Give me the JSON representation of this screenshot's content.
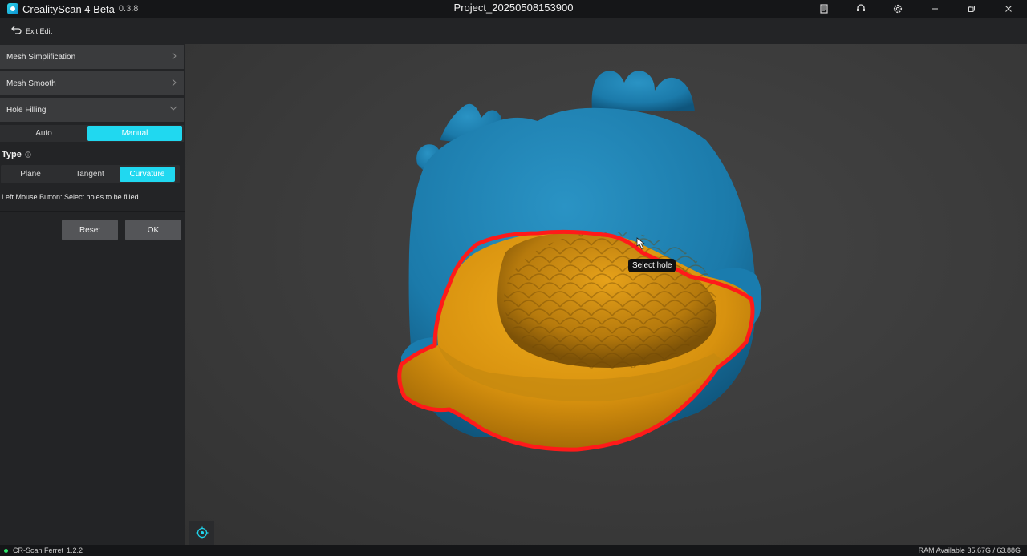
{
  "titlebar": {
    "app_name": "CrealityScan 4 Beta",
    "version": "0.3.8",
    "project": "Project_20250508153900",
    "icons": [
      "document-icon",
      "support-icon",
      "gear-icon",
      "minimize-icon",
      "restore-icon",
      "close-icon"
    ]
  },
  "toolbar": {
    "exit_label": "Exit Edit"
  },
  "panel": {
    "sections": [
      {
        "label": "Mesh Simplification",
        "state": "collapsed"
      },
      {
        "label": "Mesh Smooth",
        "state": "collapsed"
      },
      {
        "label": "Hole Filling",
        "state": "expanded"
      }
    ],
    "mode": {
      "options": [
        "Auto",
        "Manual"
      ],
      "selected": "Manual"
    },
    "type_label": "Type",
    "type": {
      "options": [
        "Plane",
        "Tangent",
        "Curvature"
      ],
      "selected": "Curvature"
    },
    "hint": "Left Mouse Button: Select holes to be filled",
    "reset_label": "Reset",
    "ok_label": "OK"
  },
  "viewport": {
    "tooltip": "Select hole",
    "colors": {
      "model": "#1f84b5",
      "fill": "#d99410",
      "hole_outline": "#ff1a1a",
      "accent": "#20d8f0"
    }
  },
  "status": {
    "device": "CR-Scan Ferret",
    "device_version": "1.2.2",
    "ram": "RAM Available 35.67G / 63.88G"
  }
}
